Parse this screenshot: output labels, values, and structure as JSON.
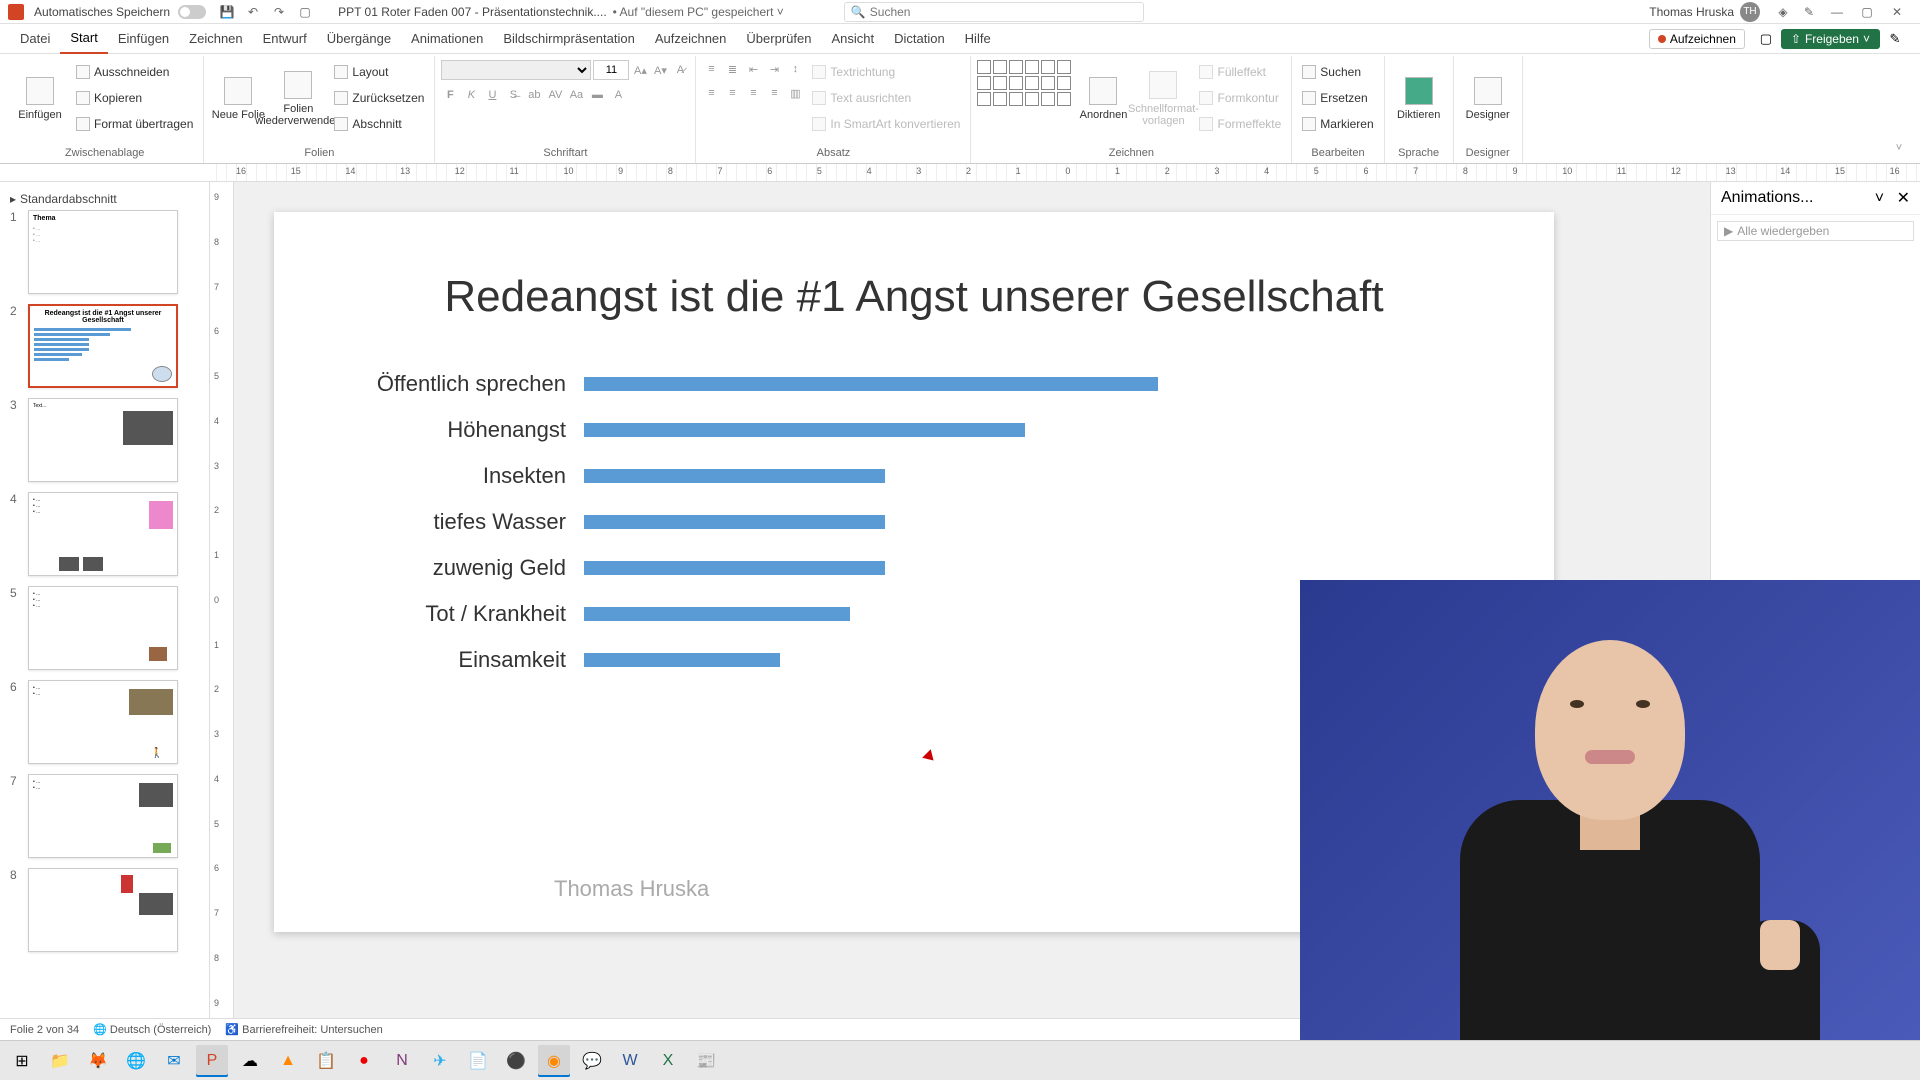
{
  "titlebar": {
    "autosave_label": "Automatisches Speichern",
    "doc_title": "PPT 01 Roter Faden 007 - Präsentationstechnik....",
    "doc_saved": "• Auf \"diesem PC\" gespeichert ˅",
    "search_placeholder": "Suchen",
    "user_name": "Thomas Hruska",
    "user_initials": "TH"
  },
  "ribbon_tabs": {
    "items": [
      "Datei",
      "Start",
      "Einfügen",
      "Zeichnen",
      "Entwurf",
      "Übergänge",
      "Animationen",
      "Bildschirmpräsentation",
      "Aufzeichnen",
      "Überprüfen",
      "Ansicht",
      "Dictation",
      "Hilfe"
    ],
    "record_label": "Aufzeichnen",
    "share_label": "Freigeben"
  },
  "ribbon": {
    "clipboard": {
      "group": "Zwischenablage",
      "paste": "Einfügen",
      "cut": "Ausschneiden",
      "copy": "Kopieren",
      "format_painter": "Format übertragen"
    },
    "slides": {
      "group": "Folien",
      "new_slide": "Neue Folie",
      "reuse": "Folien wiederverwenden",
      "layout": "Layout",
      "reset": "Zurücksetzen",
      "section": "Abschnitt"
    },
    "font": {
      "group": "Schriftart",
      "size": "11"
    },
    "paragraph": {
      "group": "Absatz",
      "text_direction": "Textrichtung",
      "align_text": "Text ausrichten",
      "smartart": "In SmartArt konvertieren"
    },
    "drawing": {
      "group": "Zeichnen",
      "arrange": "Anordnen",
      "quick_styles": "Schnellformat-vorlagen",
      "fill": "Fülleffekt",
      "outline": "Formkontur",
      "effects": "Formeffekte"
    },
    "editing": {
      "group": "Bearbeiten",
      "find": "Suchen",
      "replace": "Ersetzen",
      "select": "Markieren"
    },
    "voice": {
      "group": "Sprache",
      "dictate": "Diktieren"
    },
    "designer": {
      "group": "Designer",
      "designer": "Designer"
    }
  },
  "ruler_ticks": [
    "16",
    "15",
    "14",
    "13",
    "12",
    "11",
    "10",
    "9",
    "8",
    "7",
    "6",
    "5",
    "4",
    "3",
    "2",
    "1",
    "0",
    "1",
    "2",
    "3",
    "4",
    "5",
    "6",
    "7",
    "8",
    "9",
    "10",
    "11",
    "12",
    "13",
    "14",
    "15",
    "16"
  ],
  "ruler_v_ticks": [
    "9",
    "8",
    "7",
    "6",
    "5",
    "4",
    "3",
    "2",
    "1",
    "0",
    "1",
    "2",
    "3",
    "4",
    "5",
    "6",
    "7",
    "8",
    "9"
  ],
  "slides_panel": {
    "section": "Standardabschnitt",
    "items": [
      {
        "num": "1"
      },
      {
        "num": "2"
      },
      {
        "num": "3"
      },
      {
        "num": "4"
      },
      {
        "num": "5"
      },
      {
        "num": "6"
      },
      {
        "num": "7"
      },
      {
        "num": "8"
      }
    ]
  },
  "slide": {
    "title": "Redeangst ist die #1 Angst unserer Gesellschaft",
    "author": "Thomas Hruska"
  },
  "chart_data": {
    "type": "bar",
    "orientation": "horizontal",
    "categories": [
      "Öffentlich sprechen",
      "Höhenangst",
      "Insekten",
      "tiefes Wasser",
      "zuwenig Geld",
      "Tot / Krankheit",
      "Einsamkeit"
    ],
    "values": [
      82,
      63,
      43,
      43,
      43,
      38,
      28
    ],
    "xlim": [
      0,
      100
    ],
    "bar_color": "#5b9bd5"
  },
  "anim_pane": {
    "title": "Animations...",
    "play_all": "Alle wiedergeben"
  },
  "statusbar": {
    "slide_info": "Folie 2 von 34",
    "language": "Deutsch (Österreich)",
    "accessibility": "Barrierefreiheit: Untersuchen"
  }
}
